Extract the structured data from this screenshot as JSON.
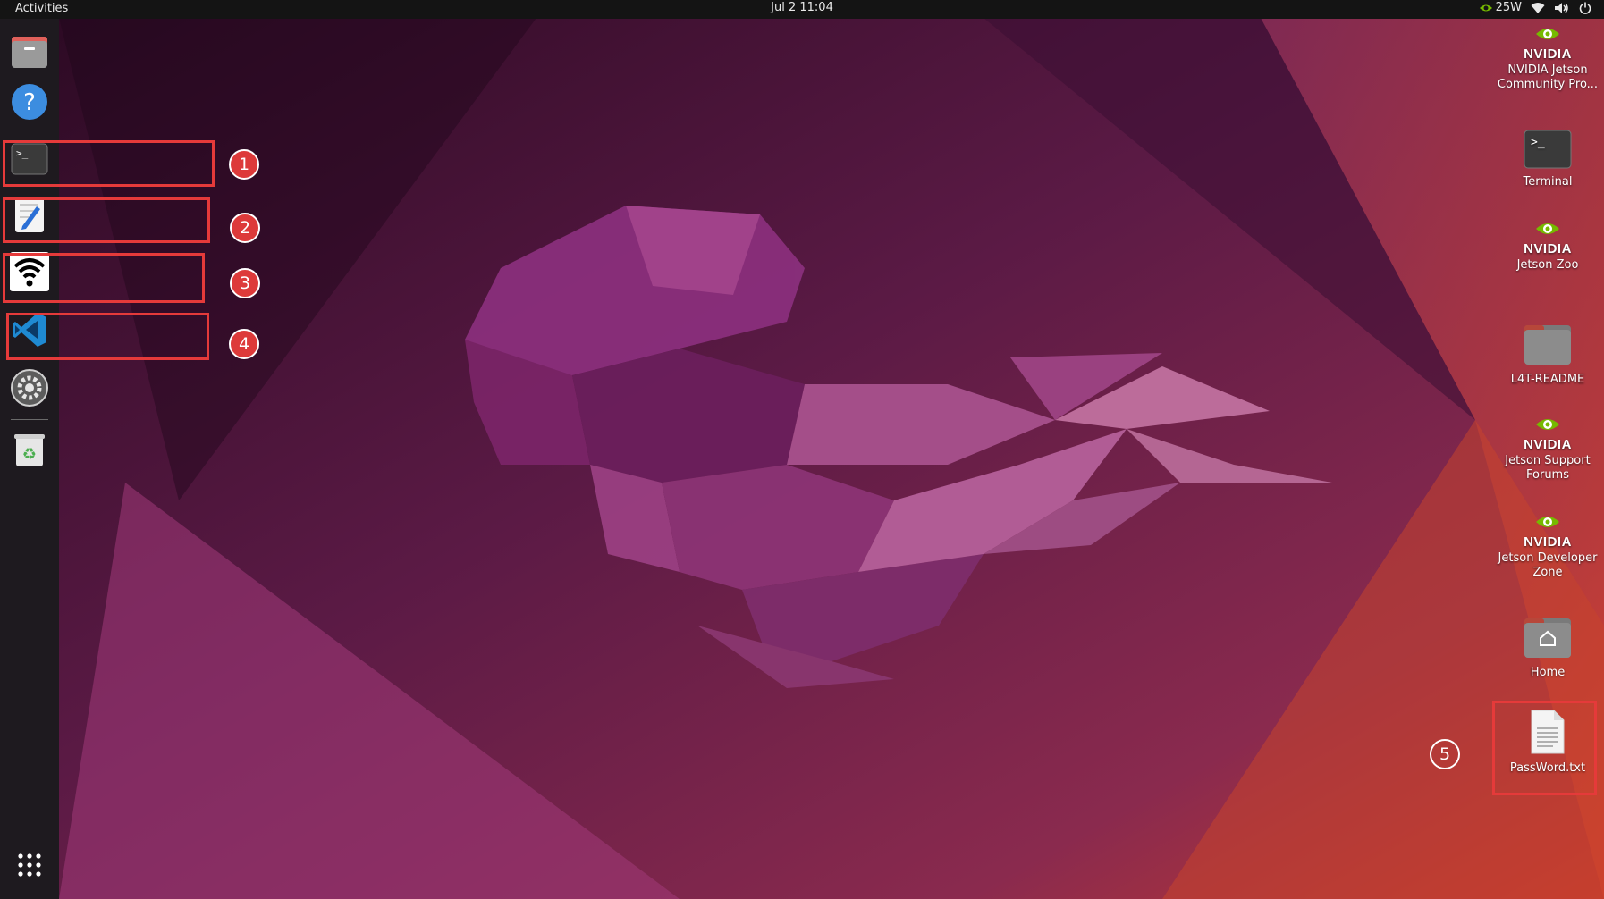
{
  "topbar": {
    "activities": "Activities",
    "clock": "Jul 2  11:04",
    "power_mode": "25W",
    "icons": [
      "nvidia-power-icon",
      "wifi-icon",
      "volume-icon",
      "power-icon"
    ]
  },
  "dock": {
    "items": [
      {
        "name": "files",
        "icon": "files-icon"
      },
      {
        "name": "help",
        "icon": "help-icon"
      },
      {
        "name": "terminal",
        "icon": "terminal-icon"
      },
      {
        "name": "text-editor",
        "icon": "text-editor-icon"
      },
      {
        "name": "wifi-settings",
        "icon": "wifi-icon"
      },
      {
        "name": "vscode",
        "icon": "vscode-icon"
      },
      {
        "name": "settings",
        "icon": "gear-icon"
      },
      {
        "name": "trash",
        "icon": "trash-icon"
      },
      {
        "name": "show-apps",
        "icon": "app-grid-icon"
      }
    ]
  },
  "annotations": {
    "labels": [
      "1",
      "2",
      "3",
      "4",
      "5"
    ],
    "color": "#e53a3a"
  },
  "desktop": {
    "icons": [
      {
        "label": "NVIDIA Jetson Community Pro...",
        "icon": "nvidia-icon"
      },
      {
        "label": "Terminal",
        "icon": "terminal-icon"
      },
      {
        "label": "Jetson Zoo",
        "icon": "nvidia-icon"
      },
      {
        "label": "L4T-README",
        "icon": "folder-icon"
      },
      {
        "label": "Jetson Support Forums",
        "icon": "nvidia-icon"
      },
      {
        "label": "Jetson Developer Zone",
        "icon": "nvidia-icon"
      },
      {
        "label": "Home",
        "icon": "home-folder-icon"
      },
      {
        "label": "PassWord.txt",
        "icon": "text-file-icon"
      }
    ],
    "nvidia_wordmark": "NVIDIA"
  },
  "colors": {
    "accent_red": "#e53a3a",
    "nvidia_green": "#76b900",
    "wallpaper_base": "#5a1a45"
  }
}
